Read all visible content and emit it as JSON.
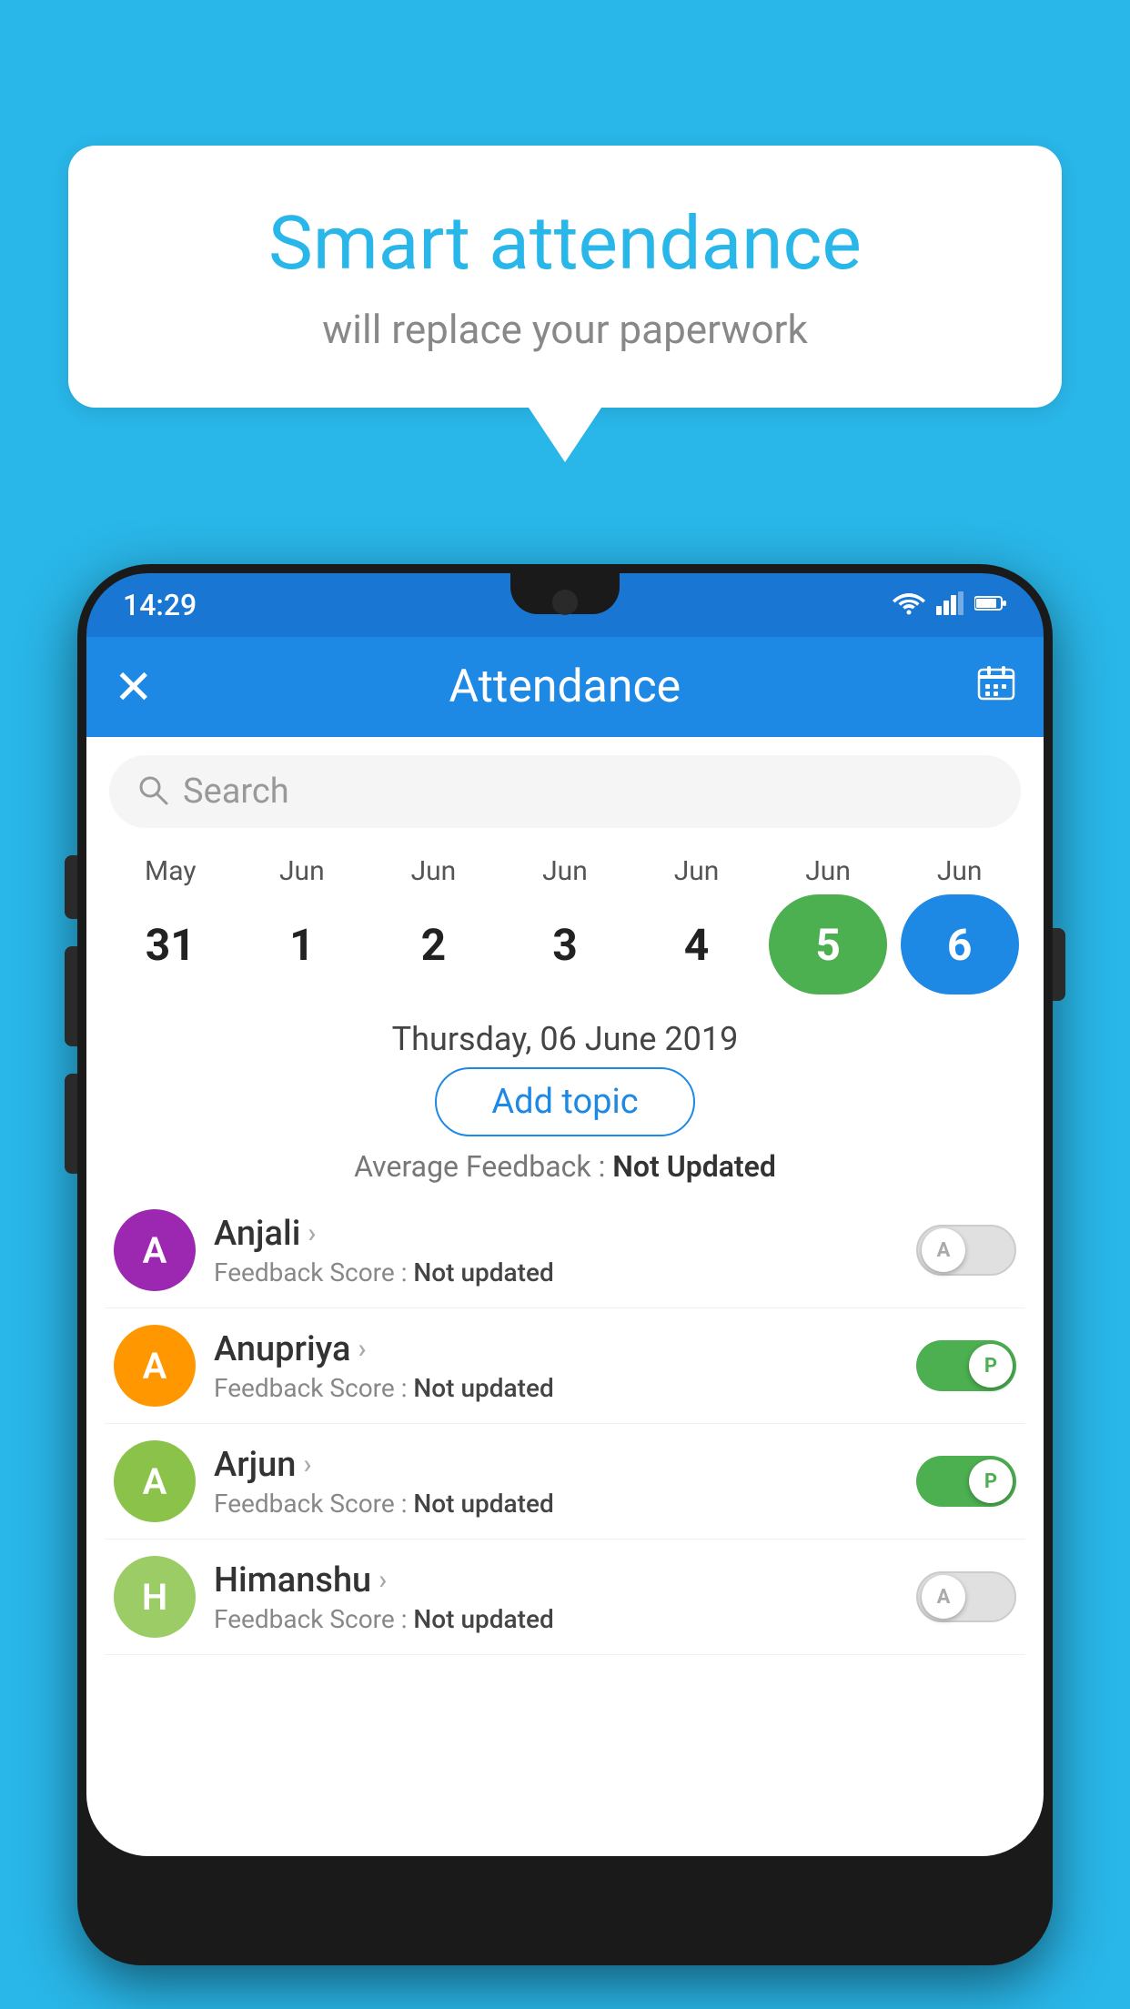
{
  "background_color": "#29B6E8",
  "speech_bubble": {
    "title": "Smart attendance",
    "subtitle": "will replace your paperwork"
  },
  "status_bar": {
    "time": "14:29",
    "wifi_icon": "▼",
    "signal_icon": "◀",
    "battery_icon": "▮"
  },
  "app_bar": {
    "title": "Attendance",
    "close_label": "✕",
    "calendar_icon": "📅"
  },
  "search": {
    "placeholder": "Search"
  },
  "calendar": {
    "months": [
      "May",
      "Jun",
      "Jun",
      "Jun",
      "Jun",
      "Jun",
      "Jun"
    ],
    "dates": [
      "31",
      "1",
      "2",
      "3",
      "4",
      "5",
      "6"
    ],
    "today_index": 5,
    "selected_index": 6
  },
  "date_label": "Thursday, 06 June 2019",
  "add_topic_label": "Add topic",
  "avg_feedback_label": "Average Feedback :",
  "avg_feedback_value": "Not Updated",
  "students": [
    {
      "name": "Anjali",
      "avatar_letter": "A",
      "avatar_color": "purple",
      "feedback_label": "Feedback Score :",
      "feedback_value": "Not updated",
      "toggle_state": "off",
      "toggle_letter": "A"
    },
    {
      "name": "Anupriya",
      "avatar_letter": "A",
      "avatar_color": "orange",
      "feedback_label": "Feedback Score :",
      "feedback_value": "Not updated",
      "toggle_state": "on",
      "toggle_letter": "P"
    },
    {
      "name": "Arjun",
      "avatar_letter": "A",
      "avatar_color": "green",
      "feedback_label": "Feedback Score :",
      "feedback_value": "Not updated",
      "toggle_state": "on",
      "toggle_letter": "P"
    },
    {
      "name": "Himanshu",
      "avatar_letter": "H",
      "avatar_color": "olive",
      "feedback_label": "Feedback Score :",
      "feedback_value": "Not updated",
      "toggle_state": "off",
      "toggle_letter": "A"
    }
  ]
}
